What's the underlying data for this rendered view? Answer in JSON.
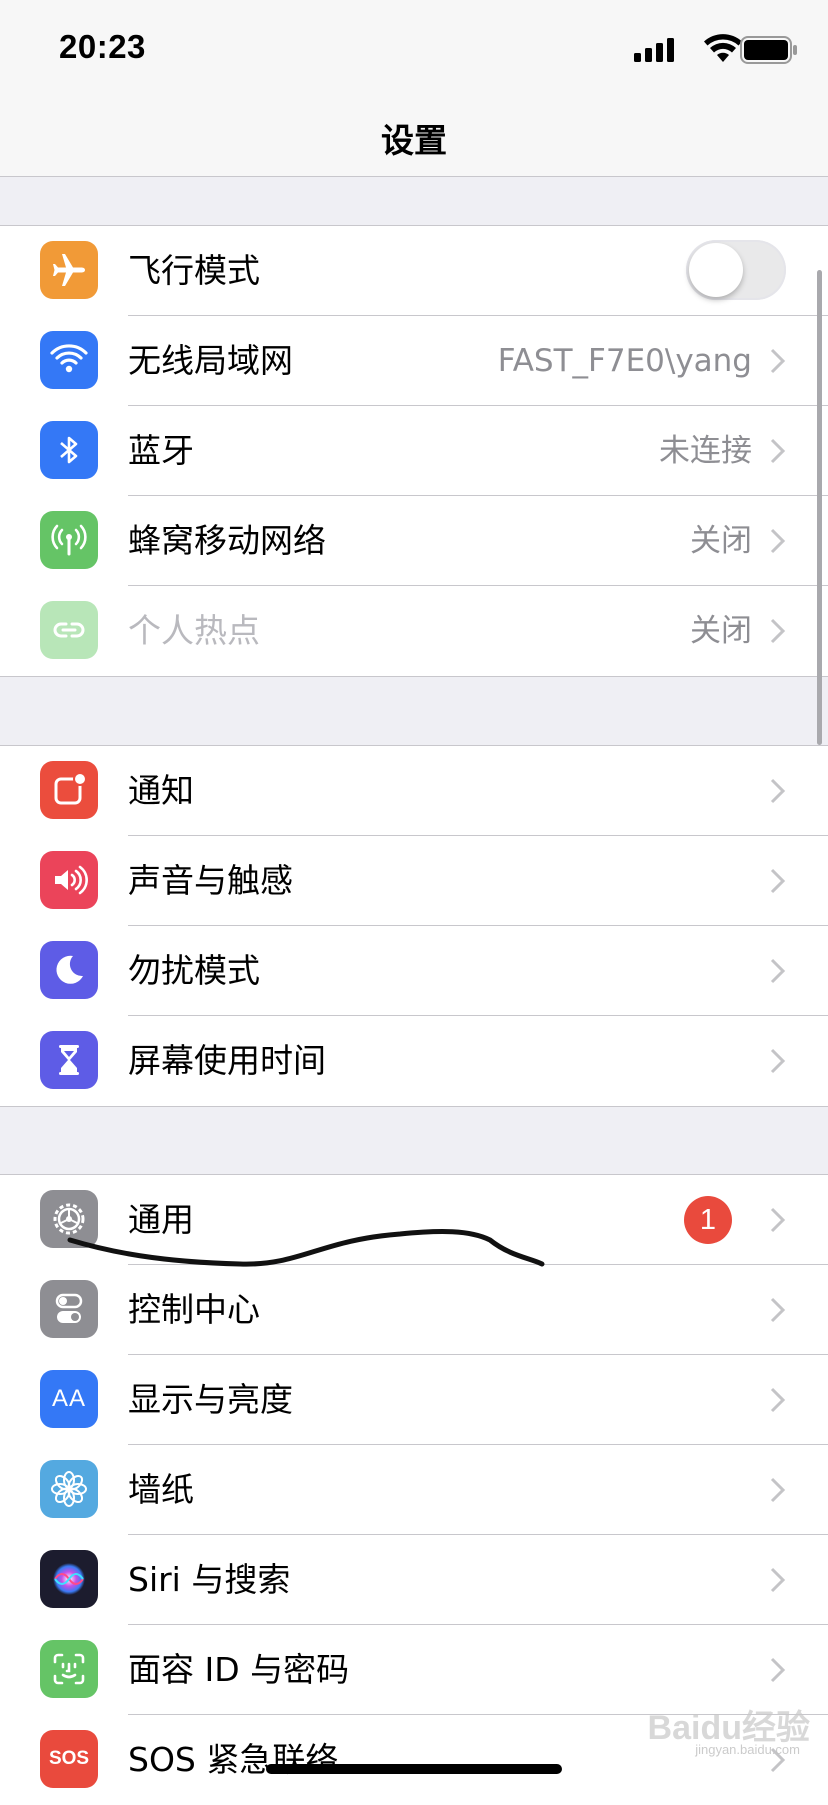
{
  "status_bar": {
    "time": "20:23"
  },
  "nav": {
    "title": "设置"
  },
  "groups": [
    {
      "rows": [
        {
          "label": "飞行模式",
          "icon": "airplane-icon",
          "color": "#f19a37",
          "control": "toggle",
          "toggle_on": false
        },
        {
          "label": "无线局域网",
          "icon": "wifi-icon",
          "color": "#3478f6",
          "value": "FAST_F7E0\\yang"
        },
        {
          "label": "蓝牙",
          "icon": "bluetooth-icon",
          "color": "#3478f6",
          "value": "未连接"
        },
        {
          "label": "蜂窝移动网络",
          "icon": "antenna-icon",
          "color": "#65c466",
          "value": "关闭"
        },
        {
          "label": "个人热点",
          "icon": "hotspot-icon",
          "color": "#b8e6b8",
          "value": "关闭",
          "disabled": true
        }
      ]
    },
    {
      "rows": [
        {
          "label": "通知",
          "icon": "notifications-icon",
          "color": "#eb4d3d"
        },
        {
          "label": "声音与触感",
          "icon": "speaker-icon",
          "color": "#eb445a"
        },
        {
          "label": "勿扰模式",
          "icon": "moon-icon",
          "color": "#5e5ce6"
        },
        {
          "label": "屏幕使用时间",
          "icon": "hourglass-icon",
          "color": "#5e5ce6"
        }
      ]
    },
    {
      "rows": [
        {
          "label": "通用",
          "icon": "gear-icon",
          "color": "#8e8e93",
          "badge": "1"
        },
        {
          "label": "控制中心",
          "icon": "switches-icon",
          "color": "#8e8e93"
        },
        {
          "label": "显示与亮度",
          "icon": "text-size-icon",
          "color": "#3478f6",
          "icon_text": "AA"
        },
        {
          "label": "墙纸",
          "icon": "flower-icon",
          "color": "#54a9e0"
        },
        {
          "label": "Siri 与搜索",
          "icon": "siri-icon",
          "color": "#1c1c2e"
        },
        {
          "label": "面容 ID 与密码",
          "icon": "face-id-icon",
          "color": "#65c466"
        },
        {
          "label": "SOS 紧急联络",
          "icon": "sos-icon",
          "color": "#e94a3d",
          "icon_text": "SOS"
        }
      ]
    }
  ],
  "watermark": {
    "text": "Baidu经验",
    "sub": "jingyan.baidu.com"
  }
}
